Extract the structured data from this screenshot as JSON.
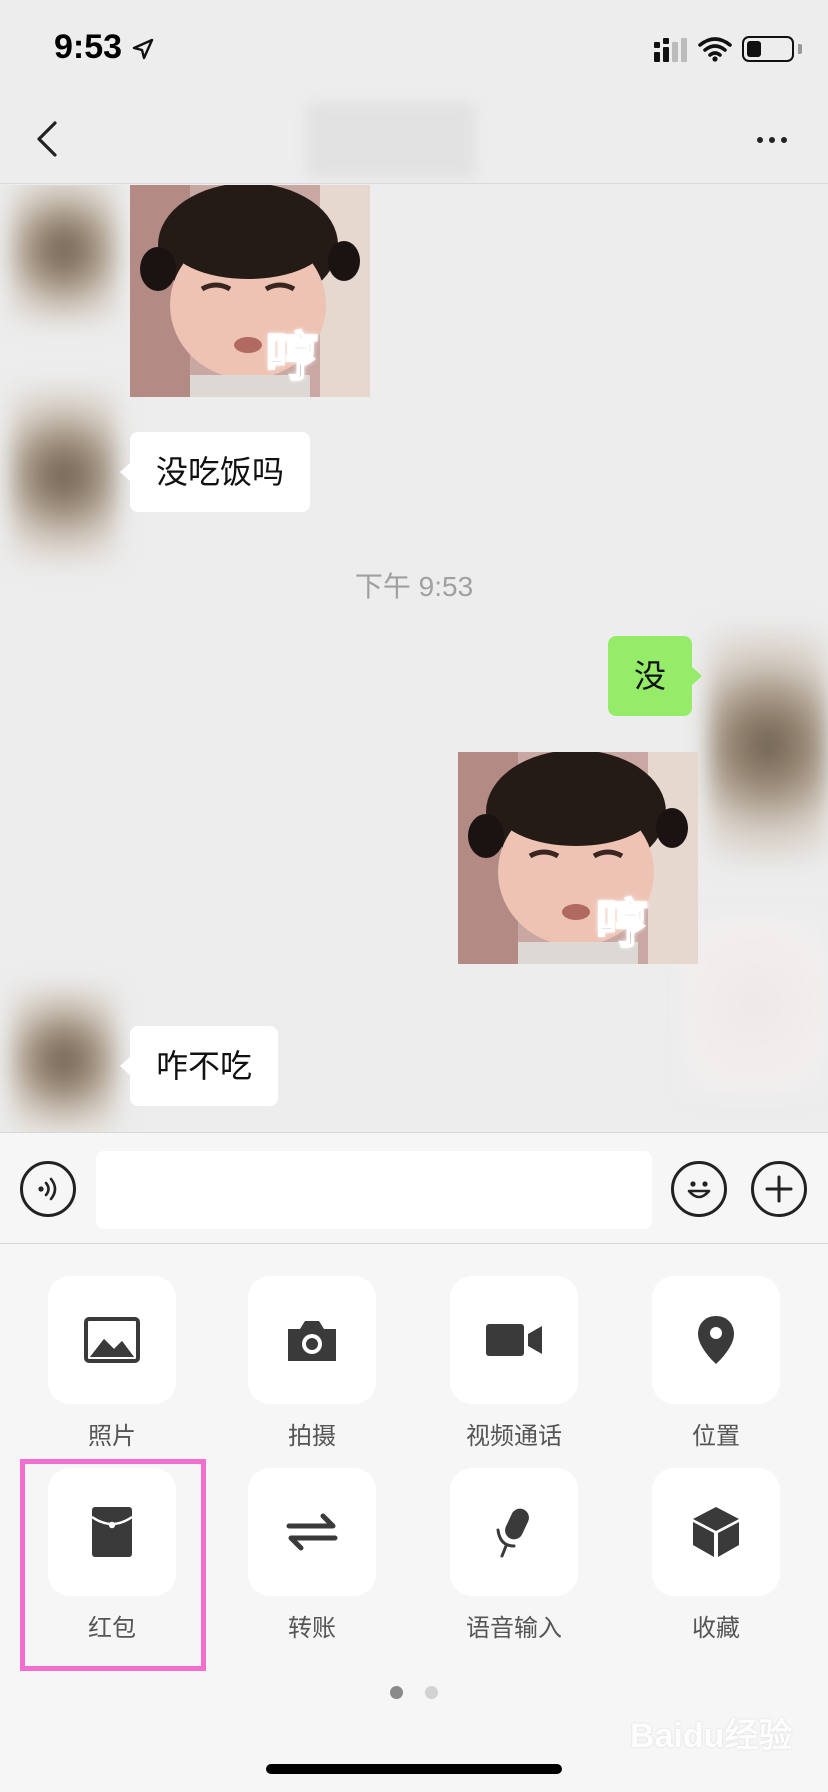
{
  "status_bar": {
    "time": "9:53"
  },
  "nav": {},
  "chat": {
    "messages": [
      {
        "side": "left",
        "type": "sticker",
        "text": "哼"
      },
      {
        "side": "left",
        "type": "text",
        "text": "没吃饭吗"
      },
      {
        "type": "timestamp",
        "text": "下午 9:53"
      },
      {
        "side": "right",
        "type": "text",
        "text": "没"
      },
      {
        "side": "right",
        "type": "sticker",
        "text": "哼"
      },
      {
        "side": "left",
        "type": "text",
        "text": "咋不吃"
      }
    ]
  },
  "input_bar": {
    "value": "",
    "placeholder": ""
  },
  "panel": {
    "tiles": [
      {
        "label": "照片",
        "icon": "photo-icon"
      },
      {
        "label": "拍摄",
        "icon": "camera-icon"
      },
      {
        "label": "视频通话",
        "icon": "video-call-icon"
      },
      {
        "label": "位置",
        "icon": "location-icon"
      },
      {
        "label": "红包",
        "icon": "red-packet-icon"
      },
      {
        "label": "转账",
        "icon": "transfer-icon"
      },
      {
        "label": "语音输入",
        "icon": "microphone-icon"
      },
      {
        "label": "收藏",
        "icon": "favorites-icon"
      }
    ],
    "pagination": {
      "current": 1,
      "total": 2
    },
    "highlighted_tile": "红包"
  },
  "watermark": "Baidu经验",
  "colors": {
    "background": "#ededed",
    "bubble_self": "#95ec69",
    "bubble_other": "#ffffff",
    "highlight": "#f26fcf",
    "icon": "#3a3a3a"
  }
}
